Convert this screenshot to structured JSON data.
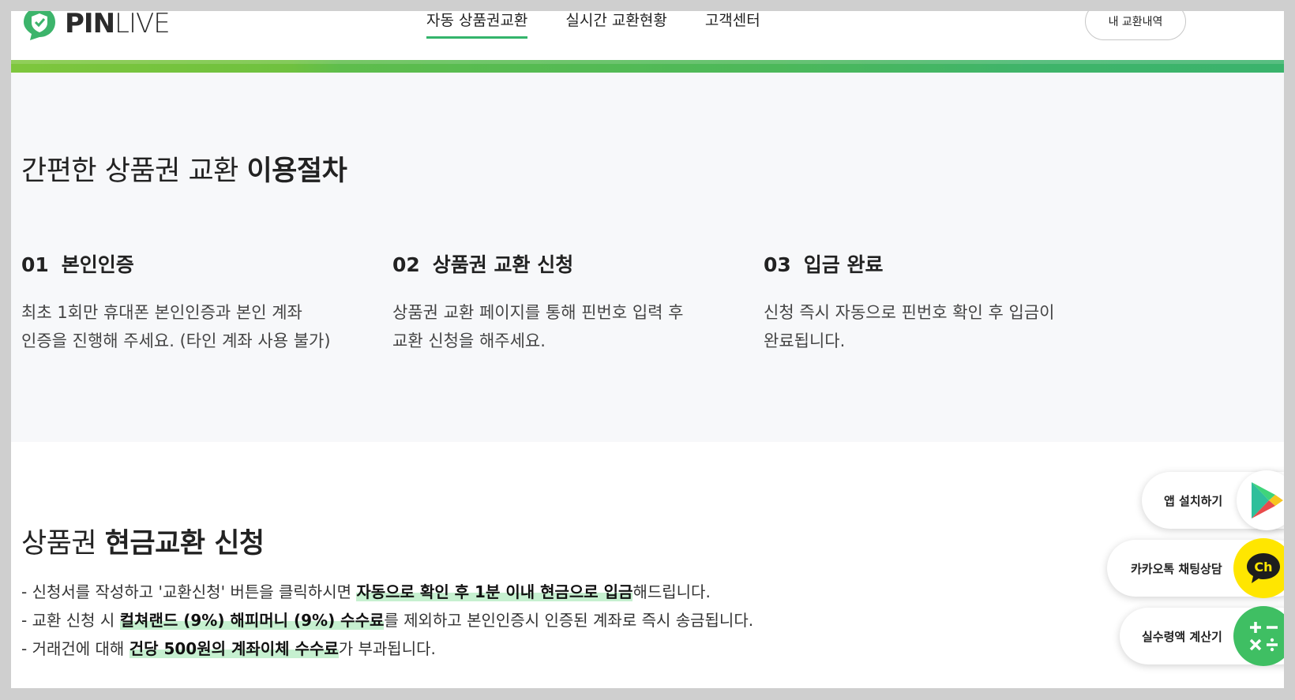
{
  "header": {
    "logo_bold": "PIN",
    "logo_light": "LIVE",
    "nav": [
      {
        "label": "자동 상품권교환"
      },
      {
        "label": "실시간 교환현황"
      },
      {
        "label": "고객센터"
      }
    ],
    "history_button": "내 교환내역"
  },
  "procedure": {
    "title_light": "간편한 상품권 교환 ",
    "title_bold": "이용절차",
    "steps": [
      {
        "num": "01",
        "label": "본인인증",
        "lines": [
          "최초 1회만 휴대폰 본인인증과 본인 계좌",
          "인증을 진행해 주세요. (타인 계좌 사용 불가)"
        ]
      },
      {
        "num": "02",
        "label": "상품권 교환 신청",
        "lines": [
          "상품권 교환 페이지를 통해 핀번호 입력 후",
          "교환 신청을 해주세요."
        ]
      },
      {
        "num": "03",
        "label": "입금 완료",
        "lines": [
          "신청 즉시 자동으로 핀번호 확인 후 입금이",
          "완료됩니다."
        ]
      }
    ]
  },
  "exchange": {
    "title_light": "상품권 ",
    "title_bold": "현금교환 신청",
    "notes": [
      {
        "pre": "- 신청서를 작성하고 '교환신청' 버튼을 클릭하시면 ",
        "bold": "자동으로 확인 후 1분 이내 현금으로 입금",
        "post": "해드립니다."
      },
      {
        "pre": "- 교환 신청 시 ",
        "bold": "컬쳐랜드 (9%) 해피머니 (9%) 수수료",
        "post": "를 제외하고 본인인증시 인증된 계좌로 즉시 송금됩니다."
      },
      {
        "pre": "- 거래건에 대해 ",
        "bold": "건당 500원의 계좌이체 수수료",
        "post": "가 부과됩니다."
      }
    ]
  },
  "floating": {
    "app": {
      "label": "앱 설치하기",
      "icon": "google-play-icon"
    },
    "kakao": {
      "label": "카카오톡 채팅상담",
      "icon_text": "Ch",
      "color": "#ffe600"
    },
    "calc": {
      "label": "실수령액 계산기",
      "icon": "calculator-icon",
      "color": "#3fbf63"
    }
  },
  "colors": {
    "accent": "#34b46b",
    "highlight": "#c6f0d0"
  }
}
